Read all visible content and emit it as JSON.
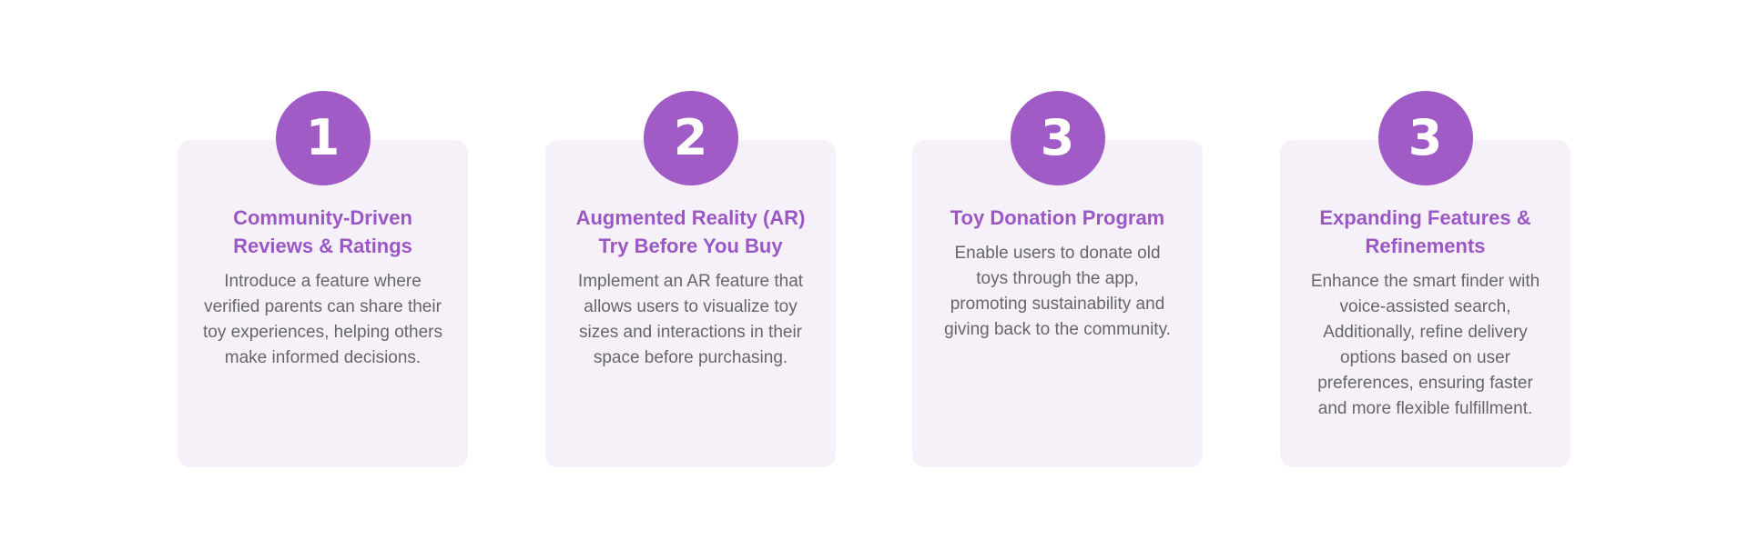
{
  "steps": [
    {
      "number": "1",
      "title": "Community-Driven Reviews & Ratings",
      "description": "Introduce a feature where verified parents can share their toy experiences, helping others make informed decisions."
    },
    {
      "number": "2",
      "title": "Augmented Reality (AR) Try Before You Buy",
      "description": "Implement an AR feature that allows users to visualize toy sizes and interactions in their space before purchasing."
    },
    {
      "number": "3",
      "title": "Toy Donation Program",
      "description": "Enable users to donate old toys through the app, promoting sustainability and giving back to the community."
    },
    {
      "number": "3",
      "title": "Expanding Features & Refinements",
      "description": "Enhance the smart finder with voice-assisted search, Additionally, refine delivery options based on user preferences, ensuring faster and more flexible fulfillment."
    }
  ],
  "colors": {
    "accent": "#a05bc7",
    "title": "#9b57c4",
    "card_background": "#f6f1f9",
    "body_text": "#666666"
  }
}
